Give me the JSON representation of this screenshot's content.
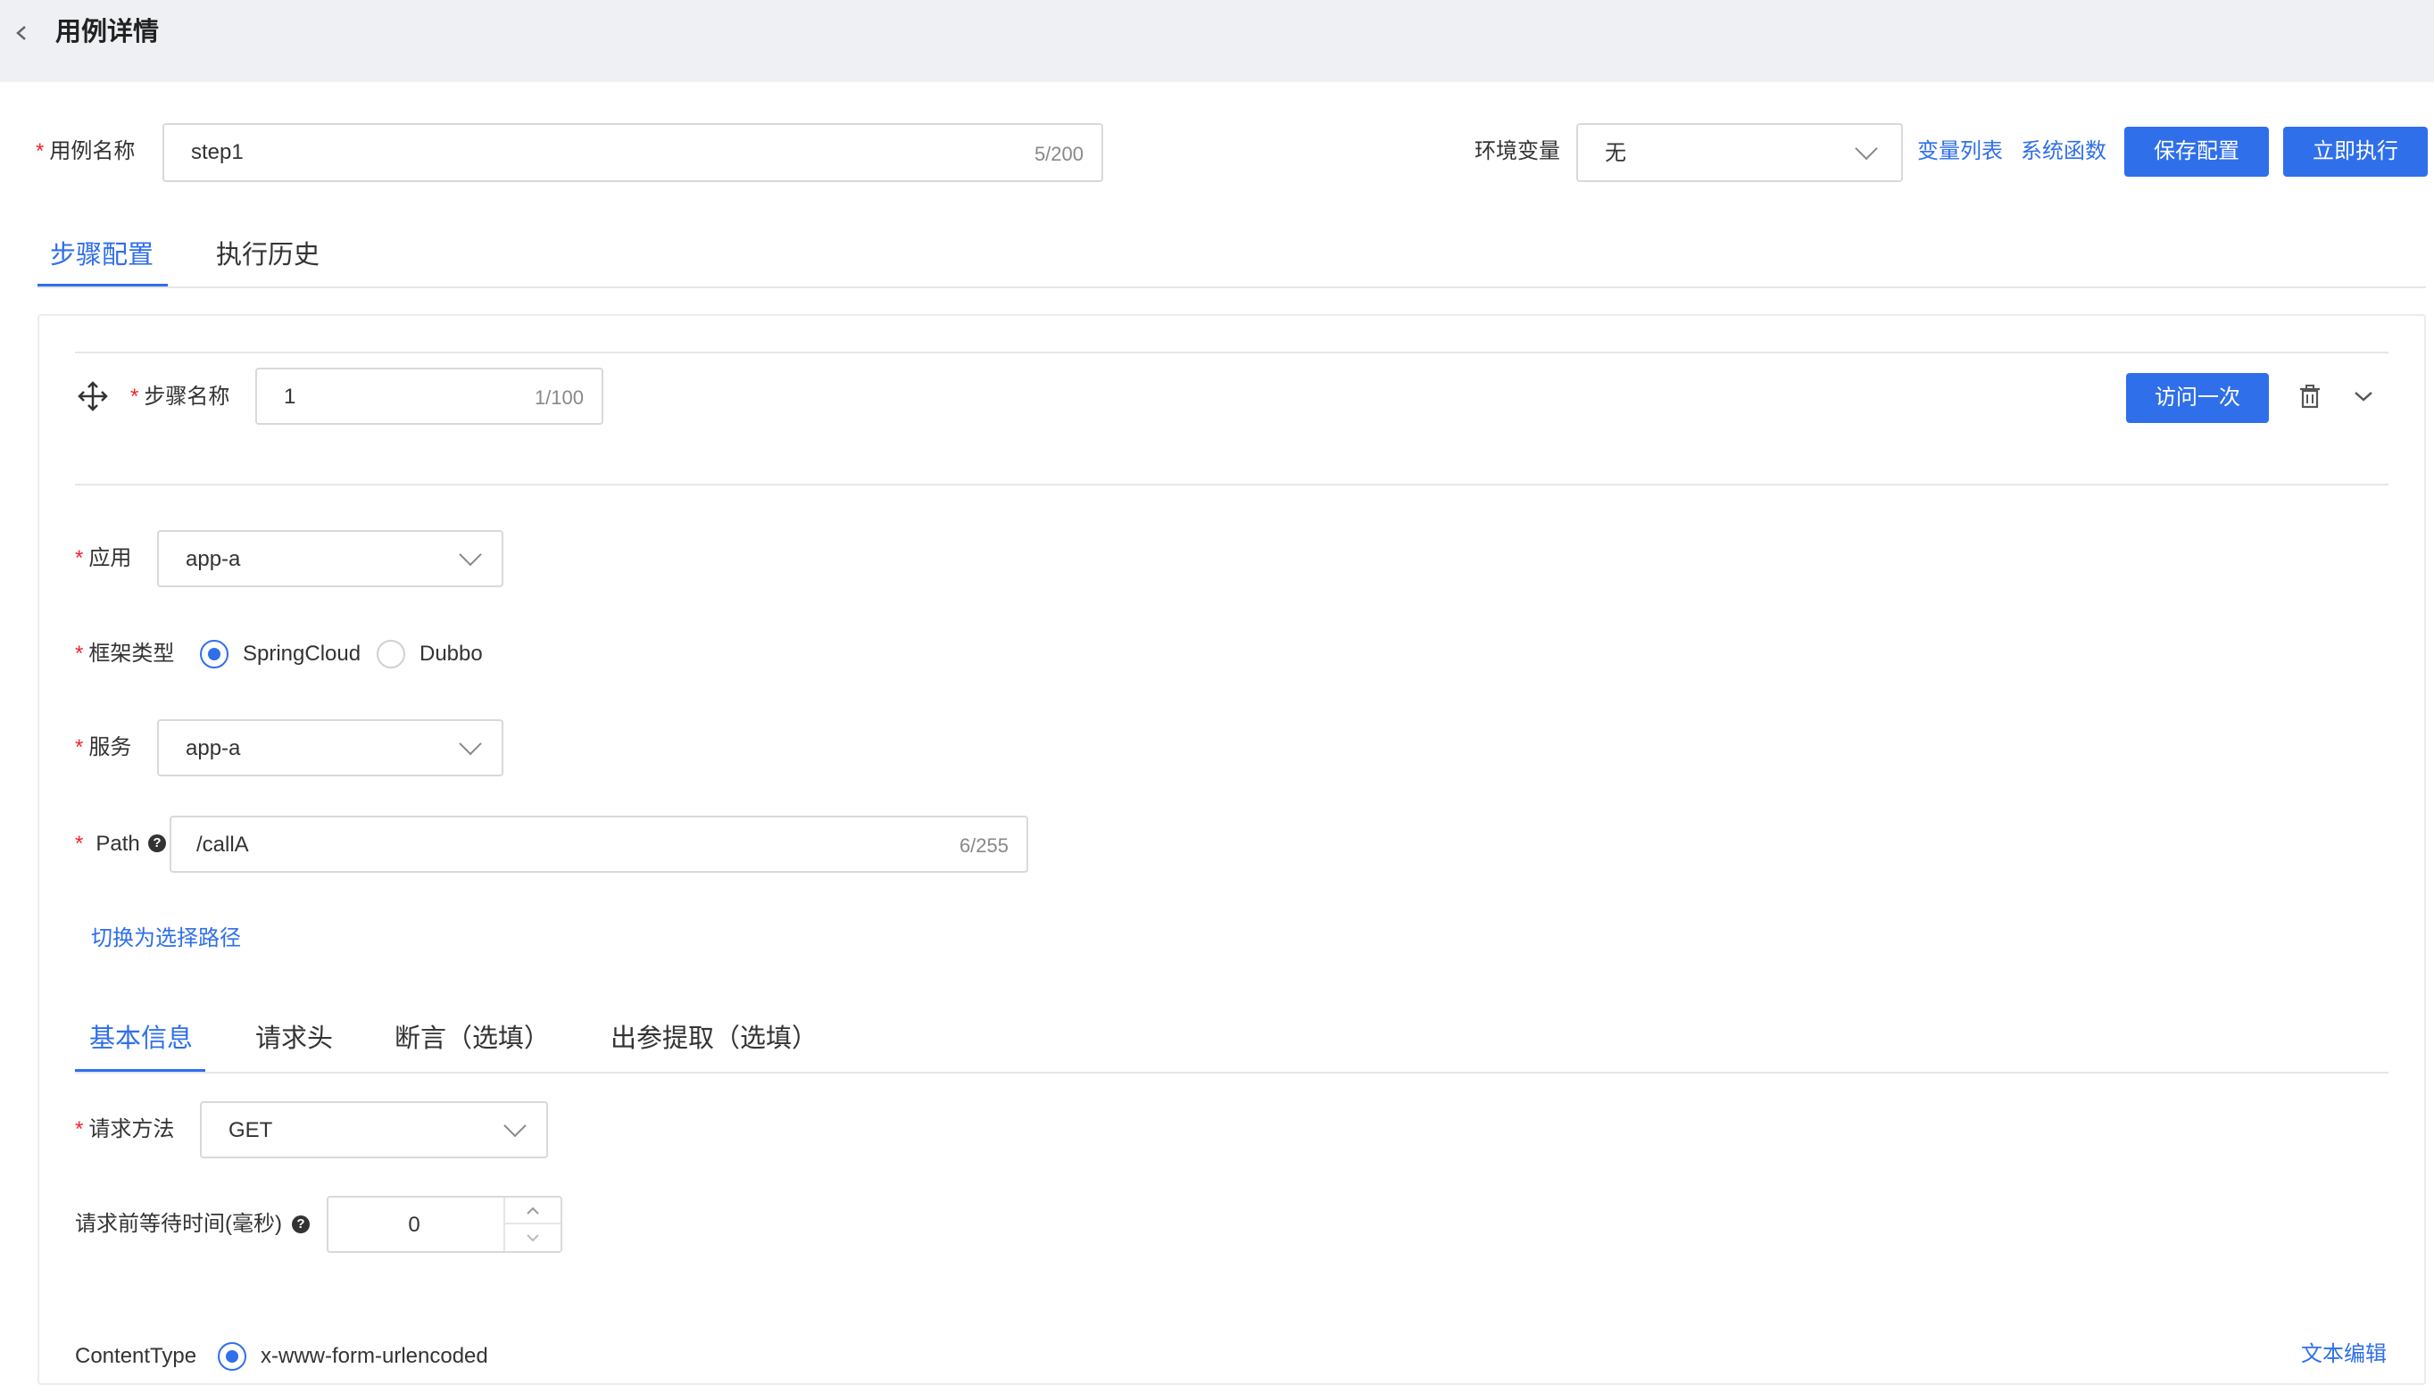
{
  "header": {
    "back_icon": "chevron-left-icon",
    "title": "用例详情"
  },
  "case_form": {
    "name_label": "用例名称",
    "name_value": "step1",
    "name_count": "5/200",
    "env_label": "环境变量",
    "env_value": "无",
    "var_list_link": "变量列表",
    "sys_func_link": "系统函数",
    "save_button": "保存配置",
    "run_button": "立即执行"
  },
  "tabs": [
    {
      "label": "步骤配置",
      "active": true
    },
    {
      "label": "执行历史",
      "active": false
    }
  ],
  "step": {
    "drag_icon": "move-icon",
    "name_label": "步骤名称",
    "name_value": "1",
    "name_count": "1/100",
    "visit_button": "访问一次",
    "delete_icon": "trash-icon",
    "collapse_icon": "chevron-down-icon",
    "app_label": "应用",
    "app_value": "app-a",
    "framework_label": "框架类型",
    "framework_options": [
      {
        "label": "SpringCloud",
        "selected": true
      },
      {
        "label": "Dubbo",
        "selected": false
      }
    ],
    "service_label": "服务",
    "service_value": "app-a",
    "path_label": "Path",
    "path_value": "/callA",
    "path_count": "6/255",
    "switch_path_link": "切换为选择路径",
    "sub_tabs": [
      {
        "label": "基本信息",
        "active": true
      },
      {
        "label": "请求头",
        "active": false
      },
      {
        "label": "断言（选填）",
        "active": false
      },
      {
        "label": "出参提取（选填）",
        "active": false
      }
    ],
    "method_label": "请求方法",
    "method_value": "GET",
    "wait_label": "请求前等待时间(毫秒)",
    "wait_value": "0",
    "content_type_label": "ContentType",
    "content_type_value": "x-www-form-urlencoded",
    "text_edit_link": "文本编辑"
  },
  "colors": {
    "accent": "#2f6fea",
    "required": "#f5222d",
    "topbar": "#eef0f4"
  }
}
